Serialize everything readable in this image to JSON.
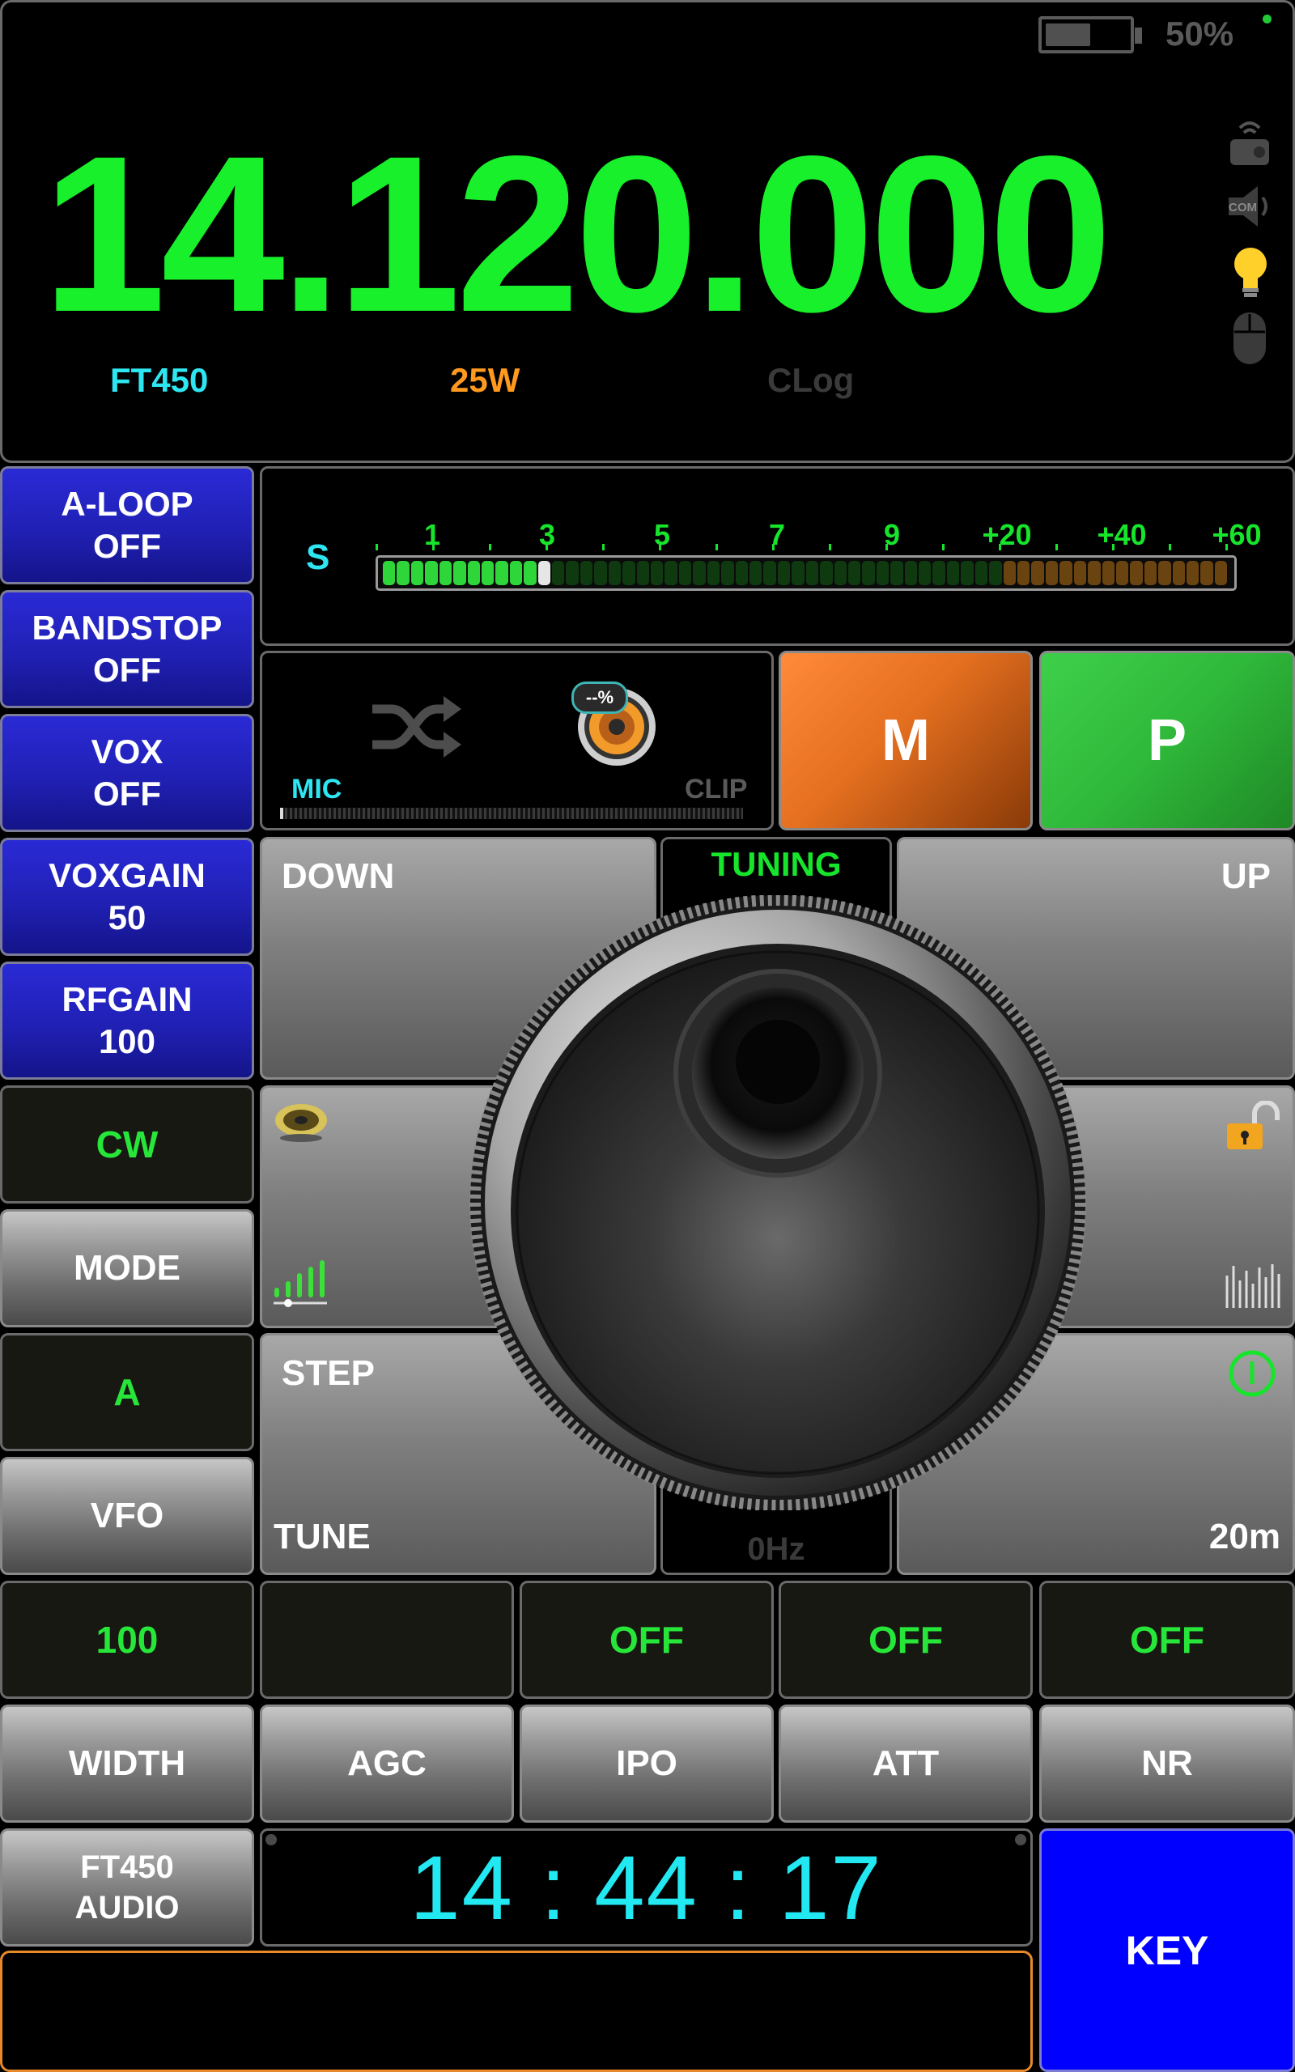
{
  "status": {
    "battery_percent": "50%",
    "battery_level": 0.5
  },
  "display": {
    "frequency": "14.120.000",
    "radio_model": "FT450",
    "power": "25W",
    "log_label": "CLog"
  },
  "side_icons": [
    "remote-radio-icon",
    "com-port-icon",
    "light-bulb-icon",
    "mouse-icon"
  ],
  "left_column": {
    "a_loop": {
      "name": "A-LOOP",
      "value": "OFF"
    },
    "bandstop": {
      "name": "BANDSTOP",
      "value": "OFF"
    },
    "vox": {
      "name": "VOX",
      "value": "OFF"
    },
    "voxgain": {
      "name": "VOXGAIN",
      "value": "50"
    },
    "rfgain": {
      "name": "RFGAIN",
      "value": "100"
    },
    "mode_value": "CW",
    "mode_label": "MODE",
    "vfo_value": "A",
    "vfo_label": "VFO"
  },
  "s_meter": {
    "label": "S",
    "ticks": [
      "1",
      "3",
      "5",
      "7",
      "9",
      "+20",
      "+40",
      "+60"
    ],
    "level_segments": 11,
    "total_segments": 60
  },
  "mic_panel": {
    "mic_label": "MIC",
    "clip_label": "CLIP",
    "speaker_badge": "--%"
  },
  "memory_button": "M",
  "p_button": "P",
  "tuning": {
    "title": "TUNING",
    "down": "DOWN",
    "up": "UP",
    "step": "STEP",
    "tune": "TUNE",
    "offset": "0Hz",
    "band": "20m"
  },
  "bottom_values": [
    "100",
    "",
    "OFF",
    "OFF",
    "OFF"
  ],
  "bottom_labels": [
    "WIDTH",
    "AGC",
    "IPO",
    "ATT",
    "NR"
  ],
  "audio_button": {
    "line1": "FT450",
    "line2": "AUDIO"
  },
  "clock": "14 : 44 : 17",
  "key_button": "KEY",
  "colors": {
    "frequency": "#17f02a",
    "model": "#2ee6f2",
    "power": "#ff9a1f",
    "log": "#3a3a3a",
    "clock": "#22e8f2",
    "memory": "#e87020",
    "p": "#2fb83a",
    "key": "#0000ff"
  }
}
